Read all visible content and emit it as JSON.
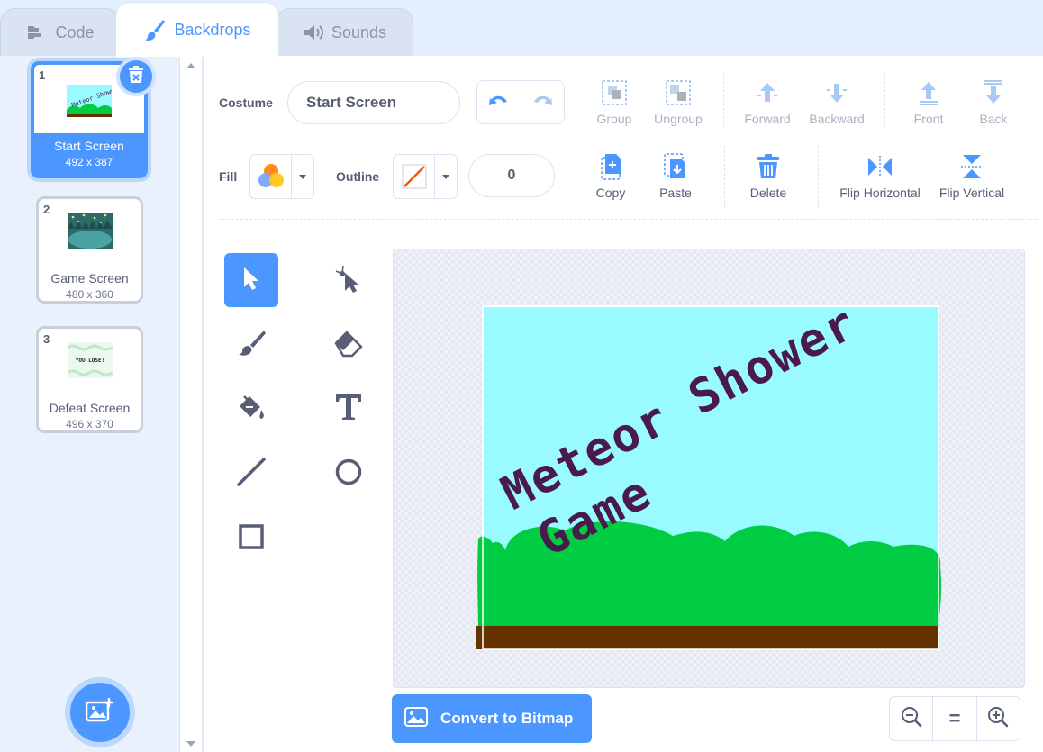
{
  "tabs": [
    {
      "label": "Code",
      "icon": "code-blocks-icon",
      "active": false
    },
    {
      "label": "Backdrops",
      "icon": "paintbrush-icon",
      "active": true
    },
    {
      "label": "Sounds",
      "icon": "speaker-icon",
      "active": false
    }
  ],
  "backdrops": [
    {
      "index": "1",
      "name": "Start Screen",
      "size": "492 x 387",
      "selected": true,
      "thumb_text": "Meteor Shower Game"
    },
    {
      "index": "2",
      "name": "Game Screen",
      "size": "480 x 360",
      "selected": false
    },
    {
      "index": "3",
      "name": "Defeat Screen",
      "size": "496 x 370",
      "selected": false,
      "thumb_text": "YOU LOSE!"
    }
  ],
  "toolbar": {
    "costume_label": "Costume",
    "costume_name": "Start Screen",
    "group_label": "Group",
    "ungroup_label": "Ungroup",
    "forward_label": "Forward",
    "backward_label": "Backward",
    "front_label": "Front",
    "back_label": "Back",
    "fill_label": "Fill",
    "outline_label": "Outline",
    "outline_width": "0",
    "copy_label": "Copy",
    "paste_label": "Paste",
    "delete_label": "Delete",
    "flip_h_label": "Flip Horizontal",
    "flip_v_label": "Flip Vertical"
  },
  "drawing_tools": [
    {
      "name": "select",
      "icon": "select-arrow-icon",
      "active": true
    },
    {
      "name": "reshape",
      "icon": "reshape-icon",
      "active": false
    },
    {
      "name": "brush",
      "icon": "brush-icon",
      "active": false
    },
    {
      "name": "eraser",
      "icon": "eraser-icon",
      "active": false
    },
    {
      "name": "fill",
      "icon": "fill-bucket-icon",
      "active": false
    },
    {
      "name": "text",
      "icon": "text-icon",
      "active": false
    },
    {
      "name": "line",
      "icon": "line-icon",
      "active": false
    },
    {
      "name": "circle",
      "icon": "circle-icon",
      "active": false
    },
    {
      "name": "rectangle",
      "icon": "rectangle-icon",
      "active": false
    }
  ],
  "canvas": {
    "title_line1": "Meteor Shower",
    "title_line2": "Game",
    "sky_color": "#99fbff",
    "grass_color": "#00cc44",
    "ground_color": "#663300",
    "title_color": "#4a1a4a"
  },
  "footer": {
    "convert_label": "Convert to Bitmap",
    "zoom_out": "zoom-out-icon",
    "zoom_reset": "=",
    "zoom_in": "zoom-in-icon"
  },
  "colors": {
    "accent": "#4c97ff",
    "text": "#575e75",
    "disabled": "#aab1bf"
  }
}
